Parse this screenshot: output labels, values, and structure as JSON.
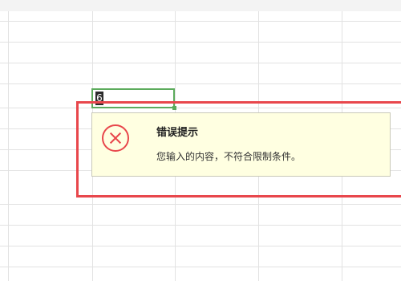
{
  "sheet": {
    "active_cell_value": "6"
  },
  "error_tip": {
    "icon": "error-x-icon",
    "title": "错误提示",
    "message": "您输入的内容，不符合限制条件。"
  },
  "colors": {
    "error_red": "#e8474c",
    "tip_background": "#ffffe1",
    "selection_green": "#5cab5c"
  }
}
